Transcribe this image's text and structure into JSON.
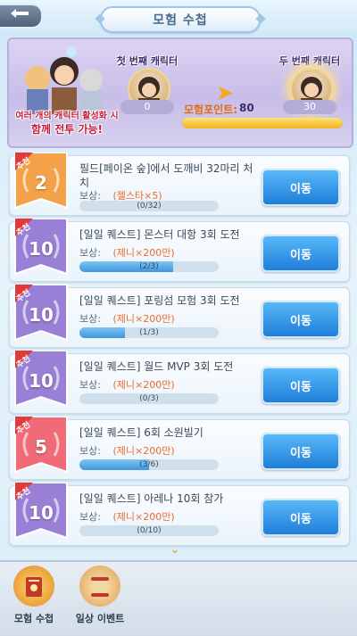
{
  "header": {
    "title": "모험 수첩"
  },
  "banner": {
    "text_line1": "여러 개의 캐릭터 활성화 시",
    "text_line2": "함께 전투 가능!",
    "slot1_label": "첫 번째 캐릭터",
    "slot1_value": "0",
    "slot2_label": "두 번째 캐릭터",
    "slot2_value": "30",
    "points_label": "모험포인트:",
    "points_value": "80",
    "points_progress": 1.0
  },
  "quests": [
    {
      "badge": "2",
      "tag": "추천",
      "title": "필드[페이온 숲]에서 도깨비 32마리 처치",
      "reward_label": "보상:",
      "reward": "(젤스타×5)",
      "progress_text": "(0/32)",
      "progress": 0.0,
      "button": "이동",
      "color": "orange"
    },
    {
      "badge": "10",
      "tag": "추천",
      "title": "[일일 퀘스트] 몬스터 대항 3회 도전",
      "reward_label": "보상:",
      "reward": "(제니×200만)",
      "progress_text": "(2/3)",
      "progress": 0.667,
      "button": "이동",
      "color": "purple"
    },
    {
      "badge": "10",
      "tag": "추천",
      "title": "[일일 퀘스트] 포링섬 모험 3회 도전",
      "reward_label": "보상:",
      "reward": "(제니×200만)",
      "progress_text": "(1/3)",
      "progress": 0.333,
      "button": "이동",
      "color": "purple"
    },
    {
      "badge": "10",
      "tag": "추천",
      "title": "[일일 퀘스트] 월드 MVP 3회 도전",
      "reward_label": "보상:",
      "reward": "(제니×200만)",
      "progress_text": "(0/3)",
      "progress": 0.0,
      "button": "이동",
      "color": "purple"
    },
    {
      "badge": "5",
      "tag": "추천",
      "title": "[일일 퀘스트] 6회 소원빌기",
      "reward_label": "보상:",
      "reward": "(제니×200만)",
      "progress_text": "(3/6)",
      "progress": 0.5,
      "button": "이동",
      "color": "red"
    },
    {
      "badge": "10",
      "tag": "추천",
      "title": "[일일 퀘스트] 아레나 10회 참가",
      "reward_label": "보상:",
      "reward": "(제니×200만)",
      "progress_text": "(0/10)",
      "progress": 0.0,
      "button": "이동",
      "color": "purple"
    }
  ],
  "bottom_tabs": [
    {
      "label": "모험 수첩",
      "icon": "book-icon"
    },
    {
      "label": "일상 이벤트",
      "icon": "scroll-icon"
    }
  ],
  "colors": {
    "orange": "#f4a24a",
    "purple": "#9a7fd6",
    "red": "#ef6b78",
    "button": "#2d8be0"
  }
}
